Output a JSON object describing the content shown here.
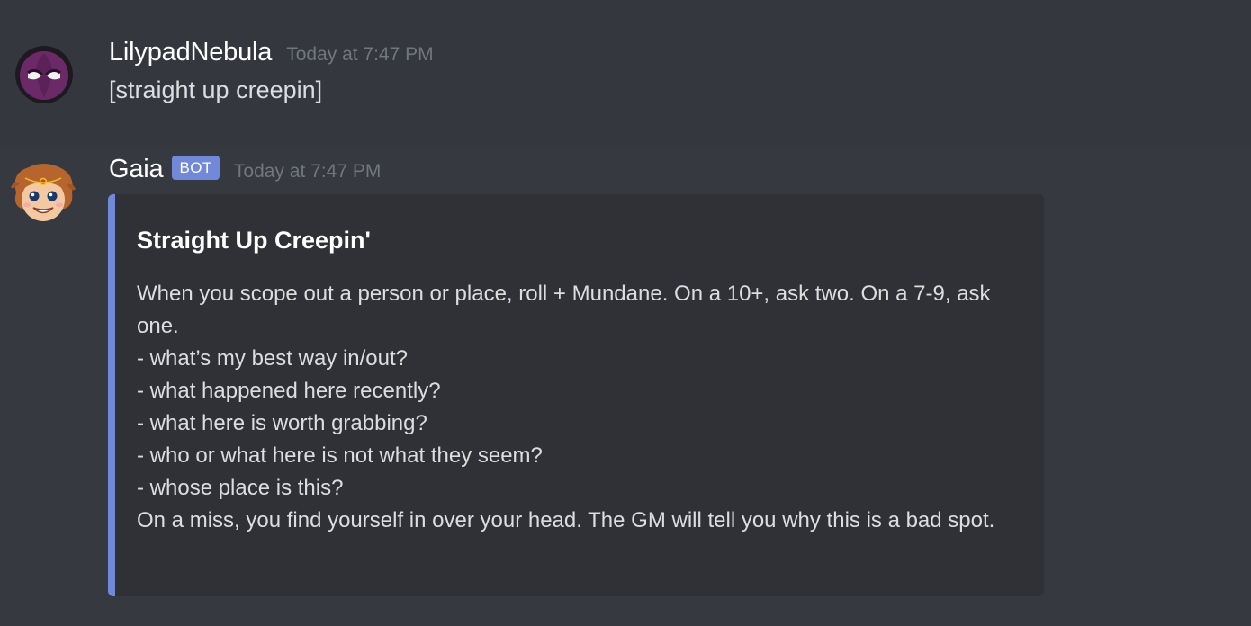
{
  "messages": [
    {
      "author": "LilypadNebula",
      "timestamp": "Today at 7:47 PM",
      "content": "[straight up creepin]"
    },
    {
      "author": "Gaia",
      "bot_tag": "BOT",
      "timestamp": "Today at 7:47 PM",
      "embed": {
        "title": "Straight Up Creepin'",
        "intro": "When you scope out a person or place, roll + Mundane. On a 10+, ask two. On a 7-9, ask one.",
        "questions": [
          "- what’s my best way in/out?",
          "- what happened here recently?",
          "- what here is worth grabbing?",
          "- who or what here is not what they seem?",
          "- whose place is this?"
        ],
        "outro": "On a miss, you find yourself in over your head. The GM will tell you why this is a bad spot."
      }
    }
  ],
  "colors": {
    "background": "#36393f",
    "embed_background": "#2f3136",
    "accent": "#7289da",
    "timestamp": "#72767d",
    "text": "#dcddde"
  }
}
